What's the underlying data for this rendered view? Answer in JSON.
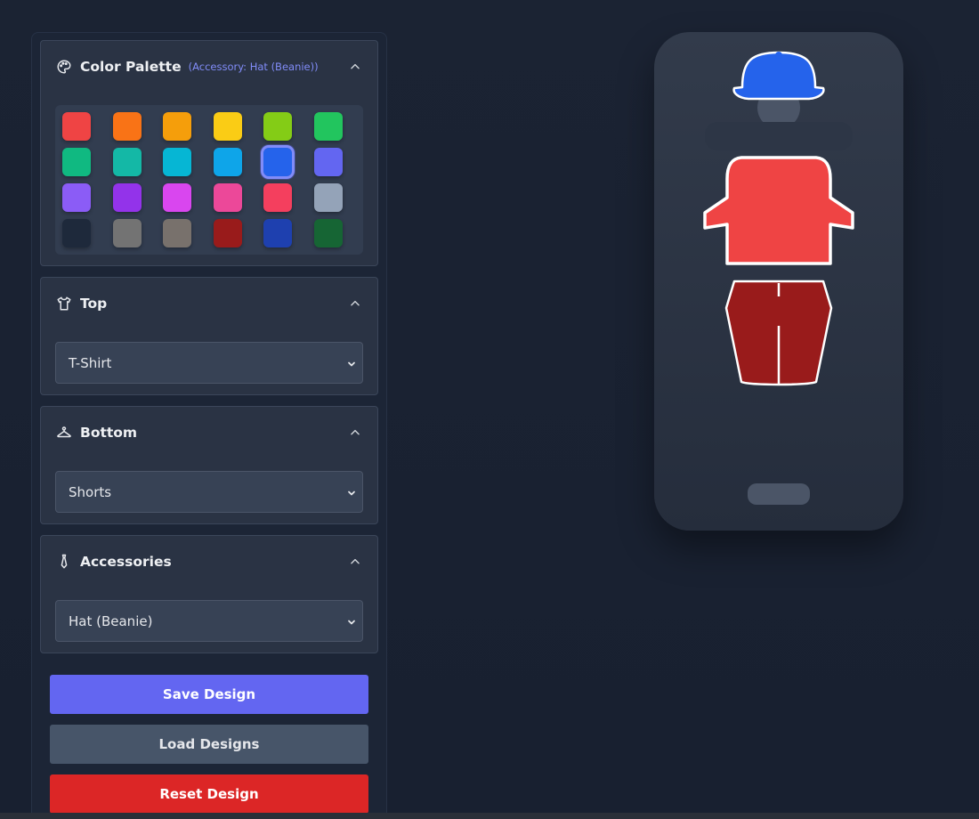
{
  "palette_panel": {
    "title": "Color Palette",
    "subtitle": "(Accessory: Hat (Beanie))",
    "selected_index": 10,
    "colors": [
      "#ef4444",
      "#f97316",
      "#f59e0b",
      "#facc15",
      "#84cc16",
      "#22c55e",
      "#10b981",
      "#14b8a6",
      "#06b6d4",
      "#0ea5e9",
      "#2563eb",
      "#6366f1",
      "#8b5cf6",
      "#9333ea",
      "#d946ef",
      "#ec4899",
      "#f43f5e",
      "#94a3b8",
      "#1e293b",
      "#737373",
      "#78716c",
      "#991b1b",
      "#1e40af",
      "#166534"
    ]
  },
  "top_panel": {
    "title": "Top",
    "value": "T-Shirt"
  },
  "bottom_panel": {
    "title": "Bottom",
    "value": "Shorts"
  },
  "accessories_panel": {
    "title": "Accessories",
    "value": "Hat (Beanie)"
  },
  "buttons": {
    "save": "Save Design",
    "load": "Load Designs",
    "reset": "Reset Design"
  },
  "preview": {
    "hat_color": "#2563eb",
    "top_color": "#ef4444",
    "bottom_color": "#991b1b"
  }
}
